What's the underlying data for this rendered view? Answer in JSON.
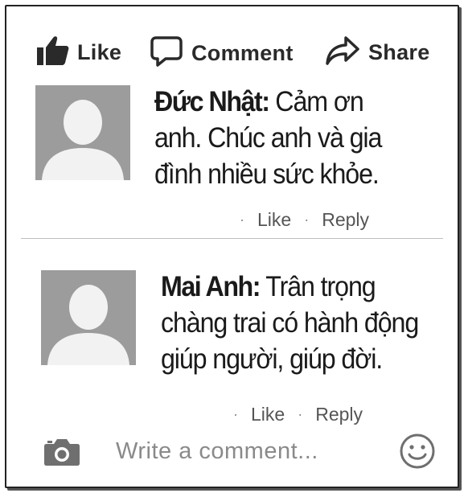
{
  "actions": {
    "like_label": "Like",
    "comment_label": "Comment",
    "share_label": "Share"
  },
  "comments": [
    {
      "author": "Đức Nhật:",
      "lines": [
        " Cảm ơn",
        "anh. Chúc anh và gia",
        "đình nhiều sức khỏe."
      ],
      "like_label": "Like",
      "reply_label": "Reply",
      "separator": "·"
    },
    {
      "author": "Mai Anh:",
      "lines": [
        " Trân trọng",
        "chàng trai có hành động",
        "giúp người, giúp đời."
      ],
      "like_label": "Like",
      "reply_label": "Reply",
      "separator": "·"
    }
  ],
  "write": {
    "placeholder": "Write a comment..."
  },
  "icons": {
    "like": "thumbs-up-icon",
    "comment": "speech-bubble-icon",
    "share": "share-arrow-icon",
    "camera": "camera-icon",
    "emoji": "smiley-icon",
    "avatar": "default-avatar-icon"
  },
  "colors": {
    "text": "#1a1a1a",
    "meta": "#555555",
    "avatar_bg": "#9c9c9c",
    "avatar_fg": "#f2f2f2",
    "placeholder": "#8a8a8a"
  }
}
